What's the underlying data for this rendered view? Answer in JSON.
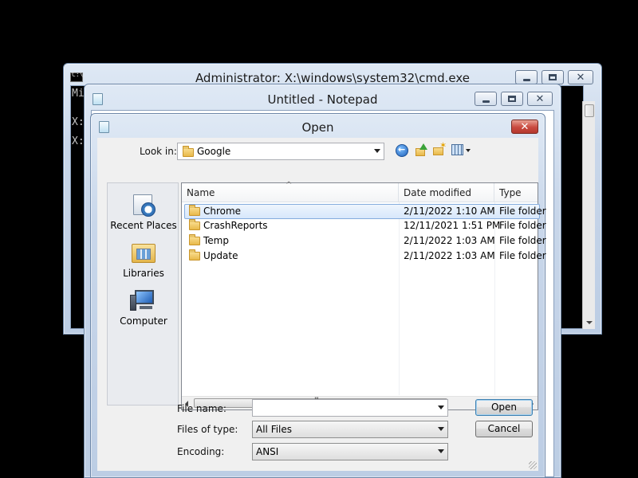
{
  "cmd": {
    "title": "Administrator: X:\\windows\\system32\\cmd.exe",
    "lines": [
      "Mi",
      "X:",
      "X:"
    ]
  },
  "notepad": {
    "title": "Untitled - Notepad"
  },
  "dialog": {
    "title": "Open",
    "look_in_label": "Look in:",
    "look_in_value": "Google",
    "places": [
      {
        "label": "Recent Places",
        "icon": "recent-places-icon"
      },
      {
        "label": "Libraries",
        "icon": "libraries-icon"
      },
      {
        "label": "Computer",
        "icon": "computer-icon"
      }
    ],
    "columns": [
      "Name",
      "Date modified",
      "Type"
    ],
    "files": [
      {
        "name": "Chrome",
        "date": "2/11/2022 1:10 AM",
        "type": "File folder",
        "selected": true
      },
      {
        "name": "CrashReports",
        "date": "12/11/2021 1:51 PM",
        "type": "File folder",
        "selected": false
      },
      {
        "name": "Temp",
        "date": "2/11/2022 1:03 AM",
        "type": "File folder",
        "selected": false
      },
      {
        "name": "Update",
        "date": "2/11/2022 1:03 AM",
        "type": "File folder",
        "selected": false
      }
    ],
    "file_name_label": "File name:",
    "file_name_value": "",
    "files_of_type_label": "Files of type:",
    "files_of_type_value": "All Files",
    "encoding_label": "Encoding:",
    "encoding_value": "ANSI",
    "open_button": "Open",
    "cancel_button": "Cancel",
    "scrollbar_grip": "III",
    "sort_indicator": "^"
  },
  "colors": {
    "selection": "#d7e7fb",
    "close_button": "#c94a3f",
    "title_text": "#1b1b1b"
  }
}
